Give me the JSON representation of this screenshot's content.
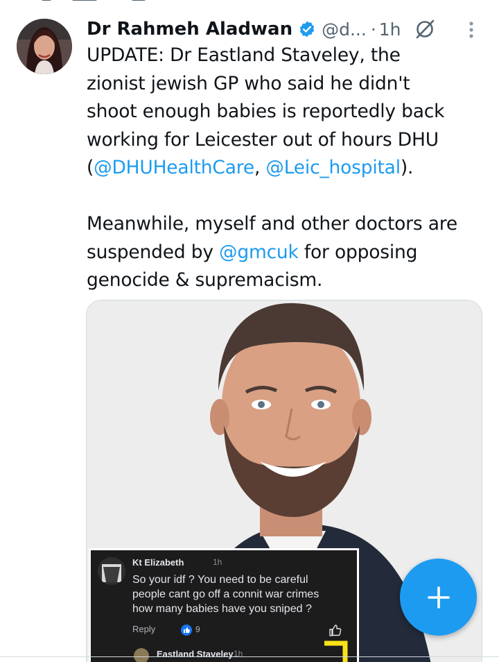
{
  "author": {
    "name": "Dr Rahmeh Aladwan",
    "handle": "@d...",
    "separator": "·",
    "time": "1h"
  },
  "icons": {
    "verified": "verified-badge-icon",
    "grok": "grok-icon",
    "more": "more-vertical-icon",
    "compose": "plus-icon"
  },
  "tweet": {
    "line1": "UPDATE: Dr Eastland Staveley, the",
    "line2": "zionist jewish GP who said he didn't",
    "line3": "shoot enough babies is reportedly back",
    "line4": "working for Leicester out of hours DHU",
    "line5_open": "(",
    "mention1": "@DHUHealthCare",
    "line5_sep": ", ",
    "mention2": "@Leic_hospital",
    "line5_close": ").",
    "line6": "Meanwhile, myself and other doctors are",
    "line7_pre": "suspended by ",
    "mention3": "@gmcuk",
    "line7_post": " for opposing",
    "line8": "genocide & supremacism."
  },
  "embedded_comment": {
    "commenter": "Kt Elizabeth",
    "commenter_time": "1h",
    "text_line1": "So your idf ? You need to be careful",
    "text_line2": "people cant go off a connit war crimes",
    "text_line3": "how many babies have you sniped ?",
    "reply_label": "Reply",
    "like_count": "9",
    "reply_author": "Eastland Staveley",
    "reply_time": "1h"
  },
  "colors": {
    "accent": "#1d9bf0",
    "text": "#0f1419",
    "secondary": "#536471"
  }
}
